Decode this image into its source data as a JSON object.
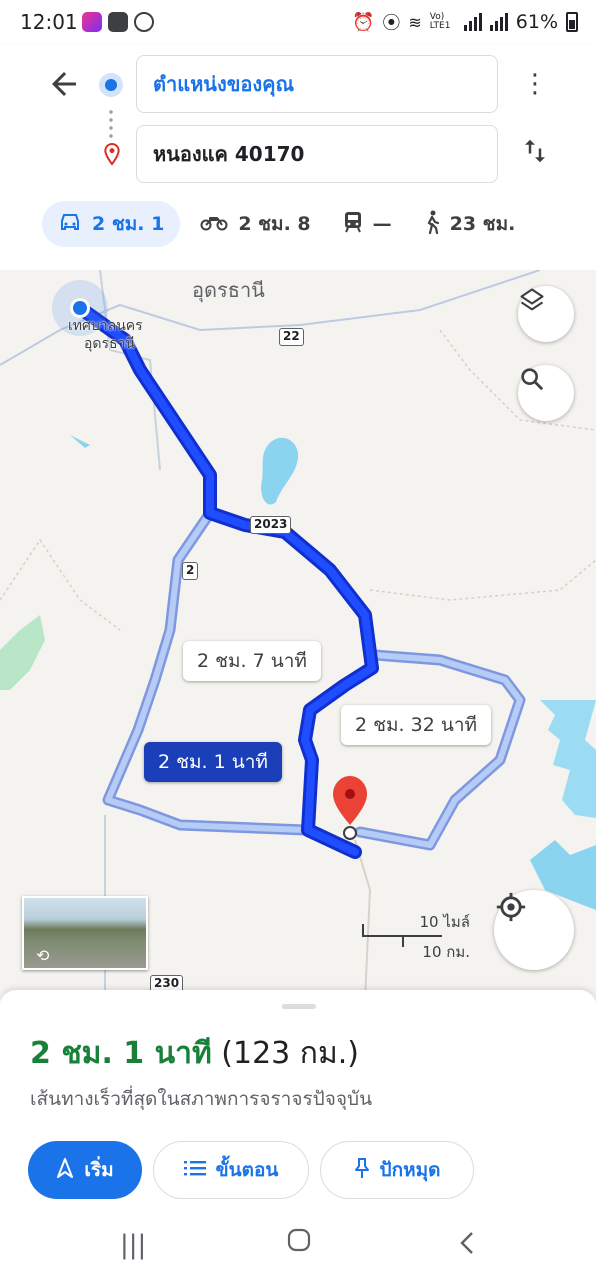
{
  "status_bar": {
    "time": "12:01",
    "battery": "61%",
    "network": "Vo) LTE1"
  },
  "header": {
    "origin": "ตำแหน่งของคุณ",
    "destination": "หนองแค 40170",
    "modes": [
      {
        "icon": "car-icon",
        "label": "2 ชม. 1",
        "active": true
      },
      {
        "icon": "motorcycle-icon",
        "label": "2 ชม. 8",
        "active": false
      },
      {
        "icon": "transit-icon",
        "label": "—",
        "active": false
      },
      {
        "icon": "walk-icon",
        "label": "23 ชม.",
        "active": false
      }
    ]
  },
  "map": {
    "region_label": "อุดรธานี",
    "city_label_1": "เทศบาลนคร",
    "city_label_2": "อุดรธานี",
    "road_22": "22",
    "road_2023": "2023",
    "road_2": "2",
    "road_230": "230",
    "route_labels": {
      "alt1": "2 ชม. 7 นาที",
      "alt2": "2 ชม. 32 นาที",
      "best": "2 ชม. 1 นาที"
    },
    "scale": {
      "miles": "10 ไมล์",
      "km": "10 กม."
    },
    "colors": {
      "route": "#1a3fff",
      "alt_route": "#a9c0f2",
      "water": "#8ad4ef",
      "park": "#b9e6c6"
    }
  },
  "sheet": {
    "duration": "2 ชม. 1 นาที",
    "distance": "(123 กม.)",
    "subtitle": "เส้นทางเร็วที่สุดในสภาพการจราจรปัจจุบัน",
    "buttons": {
      "start": "เริ่ม",
      "steps": "ขั้นตอน",
      "pin": "ปักหมุด"
    }
  }
}
